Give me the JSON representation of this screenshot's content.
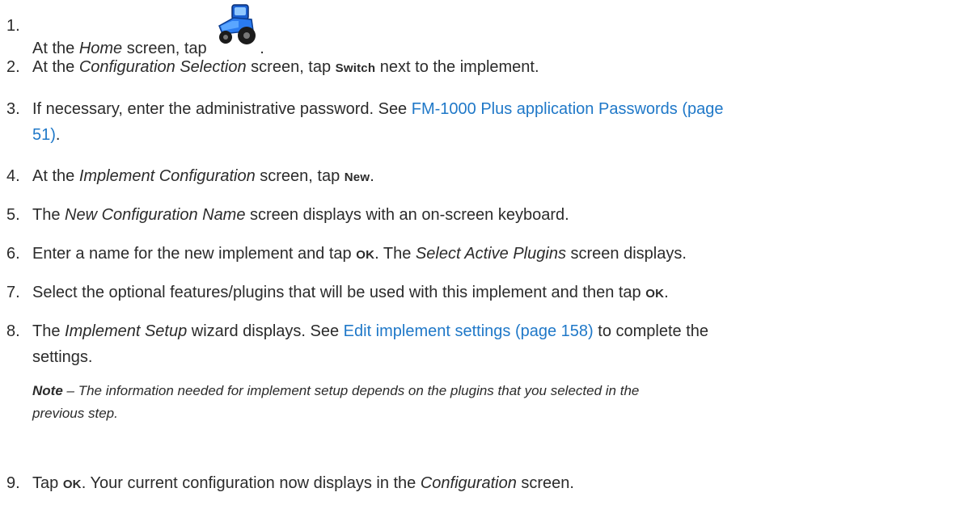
{
  "steps": [
    {
      "num": "1.",
      "pre": "At the ",
      "em": "Home",
      "post": " screen, tap ",
      "icon": "tractor-icon",
      "tail": "."
    },
    {
      "num": "2.",
      "pre": "At the ",
      "em": "Configuration Selection",
      "post": " screen, tap ",
      "ui": "Switch",
      "tail": " next to the implement."
    },
    {
      "num": "3.",
      "pre": "If necessary, enter the administrative password. See ",
      "link_l1": "FM-1000 Plus application Passwords (page",
      "link_l2": "51)",
      "tail": "."
    },
    {
      "num": "4.",
      "pre": "At the ",
      "em": "Implement Configuration",
      "post": " screen, tap ",
      "ui": "New",
      "tail": "."
    },
    {
      "num": "5.",
      "pre": "The ",
      "em": "New Configuration Name",
      "post": " screen displays with an on-screen keyboard."
    },
    {
      "num": "6.",
      "pre": "Enter a name for the new implement and tap ",
      "ui": "OK",
      "mid": ". The ",
      "em": "Select Active Plugins",
      "post": " screen displays."
    },
    {
      "num": "7.",
      "pre": "Select the optional features/plugins that will be used with this implement and then tap ",
      "ui": "OK",
      "tail": "."
    },
    {
      "num": "8.",
      "pre": "The ",
      "em": "Implement Setup",
      "post": " wizard displays. See ",
      "link": "Edit implement settings (page 158)",
      "tail": " to complete the",
      "tail_l2": "settings."
    },
    {
      "num": "9.",
      "pre": "Tap ",
      "ui": "OK",
      "mid": ". Your current configuration now displays in the ",
      "em": "Configuration",
      "post": " screen."
    }
  ],
  "note": {
    "label": "Note",
    "dash": " – ",
    "line1": "The information needed for implement setup depends on the plugins that you selected in the",
    "line2": "previous step."
  },
  "colors": {
    "link": "#1f78c8",
    "text": "#2b2b2b"
  }
}
